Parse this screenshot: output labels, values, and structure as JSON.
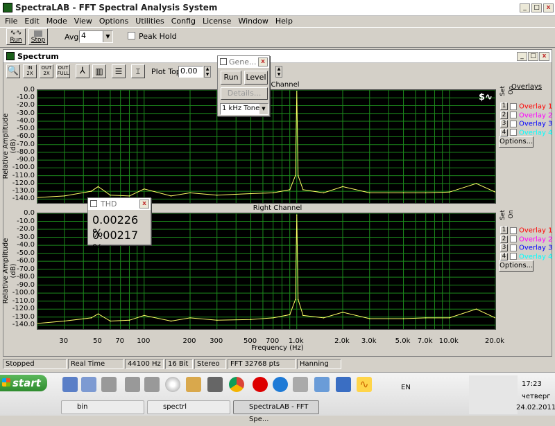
{
  "app": {
    "title": "SpectraLAB - FFT Spectral Analysis System",
    "menu": [
      "File",
      "Edit",
      "Mode",
      "View",
      "Options",
      "Utilities",
      "Config",
      "License",
      "Window",
      "Help"
    ],
    "toolbar": {
      "run_label": "Run",
      "stop_label": "Stop",
      "avg_label": "Avg:",
      "avg_value": "4",
      "peak_hold_label": "Peak Hold"
    }
  },
  "spectrum_window": {
    "title": "Spectrum",
    "plot_top_label": "Plot Top:",
    "plot_top_value": "0.00",
    "toolbar_buttons": [
      "zoom",
      "zoom-in-2x",
      "zoom-out-2x",
      "zoom-out-full",
      "line-mode",
      "bar-mode",
      "settings",
      "cursor"
    ],
    "tb_text": {
      "in2x": "IN 2X",
      "out2x": "OUT 2X",
      "outfull": "OUT FULL"
    }
  },
  "generator": {
    "title": "Gene...",
    "run": "Run",
    "level": "Level",
    "details": "Details...",
    "tone": "1 kHz Tone"
  },
  "thd": {
    "title": "THD",
    "value1": "0.00226 %",
    "value2": "0.00217 %"
  },
  "channels": [
    {
      "title": "Left Channel",
      "ylabel": "Relative Amplitude (dB)"
    },
    {
      "title": "Right Channel",
      "ylabel": "Relative Amplitude (dB)"
    }
  ],
  "overlays": {
    "header": "Overlays",
    "set_label": "Set",
    "on_label": "On",
    "items": [
      {
        "num": "1",
        "label": "Overlay 1",
        "color": "#ff0000"
      },
      {
        "num": "2",
        "label": "Overlay 2",
        "color": "#ff00ff"
      },
      {
        "num": "3",
        "label": "Overlay 3",
        "color": "#0000ff"
      },
      {
        "num": "4",
        "label": "Overlay 4",
        "color": "#00ffff"
      }
    ],
    "options": "Options..."
  },
  "chart_data": [
    {
      "type": "line",
      "title": "",
      "xlabel": "Frequency (Hz)",
      "ylabel": "Relative Amplitude (dB)",
      "x_scale": "log",
      "xlim": [
        20,
        20000
      ],
      "ylim": [
        -145,
        0
      ],
      "grid": true,
      "yticks": [
        "0.0",
        "-10.0",
        "-20.0",
        "-30.0",
        "-40.0",
        "-50.0",
        "-60.0",
        "-70.0",
        "-80.0",
        "-90.0",
        "-100.0",
        "-110.0",
        "-120.0",
        "-130.0",
        "-140.0"
      ],
      "series": [
        {
          "name": "Left Channel",
          "color": "#ffff66",
          "x": [
            20,
            30,
            45,
            50,
            60,
            80,
            100,
            150,
            200,
            300,
            500,
            700,
            900,
            980,
            1000,
            1020,
            1100,
            1500,
            2000,
            3000,
            5000,
            7000,
            10000,
            15000,
            20000
          ],
          "y": [
            -138,
            -136,
            -130,
            -124,
            -135,
            -136,
            -127,
            -136,
            -132,
            -135,
            -133,
            -132,
            -128,
            -110,
            -2,
            -110,
            -128,
            -132,
            -124,
            -132,
            -132,
            -132,
            -131,
            -120,
            -131
          ]
        }
      ]
    },
    {
      "type": "line",
      "title": "",
      "xlabel": "Frequency (Hz)",
      "ylabel": "Relative Amplitude (dB)",
      "x_scale": "log",
      "xlim": [
        20,
        20000
      ],
      "ylim": [
        -145,
        0
      ],
      "grid": true,
      "xticks": [
        "30",
        "50",
        "70",
        "100",
        "200",
        "300",
        "500",
        "700",
        "1.0k",
        "2.0k",
        "3.0k",
        "5.0k",
        "7.0k",
        "10.0k",
        "20.0k"
      ],
      "series": [
        {
          "name": "Right Channel",
          "color": "#ffff66",
          "x": [
            20,
            30,
            45,
            50,
            60,
            80,
            100,
            150,
            200,
            300,
            500,
            700,
            900,
            980,
            1000,
            1020,
            1100,
            1500,
            2000,
            3000,
            5000,
            7000,
            10000,
            15000,
            20000
          ],
          "y": [
            -138,
            -135,
            -131,
            -126,
            -135,
            -134,
            -128,
            -135,
            -131,
            -134,
            -133,
            -131,
            -127,
            -108,
            -2,
            -108,
            -128,
            -131,
            -124,
            -132,
            -132,
            -131,
            -131,
            -120,
            -131
          ]
        }
      ]
    }
  ],
  "freq_label": "Frequency (Hz)",
  "status": [
    "Stopped",
    "Real Time",
    "44100 Hz",
    "16 Bit",
    "Stereo",
    "FFT 32768 pts",
    "Hanning"
  ],
  "taskbar": {
    "start": "start",
    "tasks": [
      "bin",
      "spectrl",
      "SpectraLAB - FFT Spe..."
    ],
    "lang": "EN",
    "time": "17:23",
    "day": "четверг",
    "date": "24.02.2011"
  }
}
